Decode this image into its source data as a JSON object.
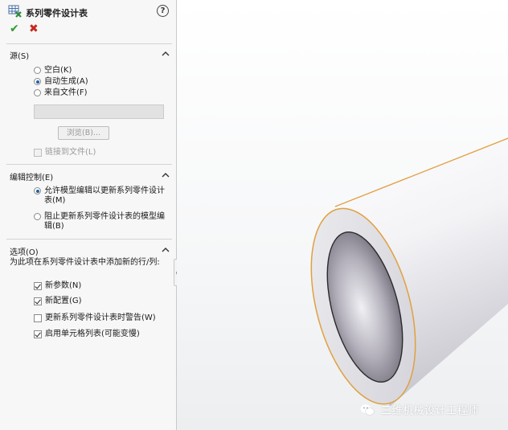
{
  "panel": {
    "title": "系列零件设计表",
    "help": "?",
    "source": {
      "heading": "源(S)",
      "options": [
        {
          "label": "空白(K)",
          "selected": false
        },
        {
          "label": "自动生成(A)",
          "selected": true
        },
        {
          "label": "来自文件(F)",
          "selected": false
        }
      ],
      "browse_label": "浏览(B)...",
      "link_label": "链接到文件(L)",
      "link_checked": false
    },
    "edit_control": {
      "heading": "编辑控制(E)",
      "options": [
        {
          "label": "允许模型编辑以更新系列零件设计表(M)",
          "selected": true
        },
        {
          "label": "阻止更新系列零件设计表的模型编辑(B)",
          "selected": false
        }
      ]
    },
    "options": {
      "heading": "选项(O)",
      "description": "为此项在系列零件设计表中添加新的行/列:",
      "items": [
        {
          "label": "新参数(N)",
          "checked": true
        },
        {
          "label": "新配置(G)",
          "checked": true
        },
        {
          "label": "更新系列零件设计表时警告(W)",
          "checked": false
        },
        {
          "label": "启用单元格列表(可能变慢)",
          "checked": true
        }
      ]
    }
  },
  "watermark": {
    "text": "三维机械设计工程师"
  },
  "colors": {
    "accept": "#2e9e2e",
    "cancel": "#c8281e",
    "pipe_edge": "#e0a040",
    "pipe_outer": "#e6e6ea",
    "pipe_inner": "#8c8896"
  }
}
